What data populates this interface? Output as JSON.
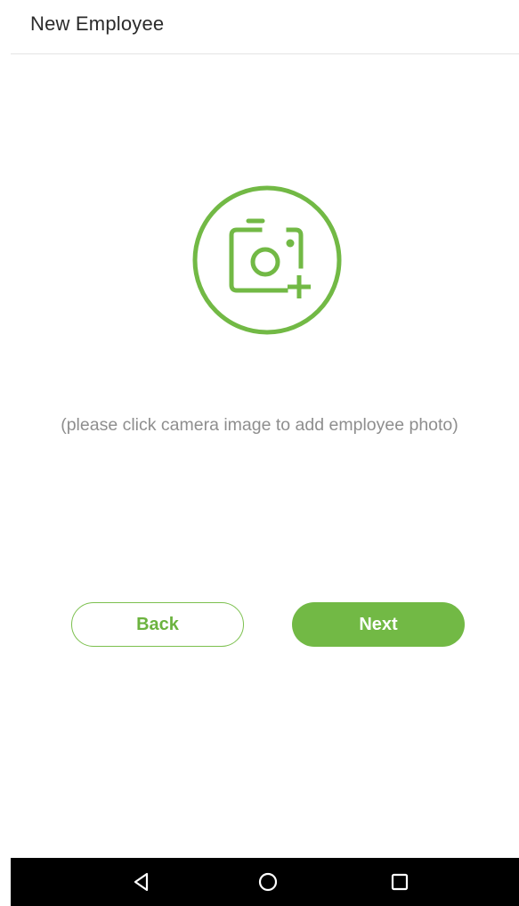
{
  "header": {
    "title": "New Employee"
  },
  "photo": {
    "icon": "camera-add-icon",
    "hint": "(please click camera image to add employee photo)"
  },
  "actions": {
    "back_label": "Back",
    "next_label": "Next"
  },
  "navigation": {
    "back_icon": "triangle-back-icon",
    "home_icon": "circle-home-icon",
    "recent_icon": "square-recent-apps-icon"
  },
  "colors": {
    "accent": "#72b945",
    "hint_text": "#8e8e8e",
    "title_text": "#2b2b2b",
    "nav_background": "#000000"
  }
}
